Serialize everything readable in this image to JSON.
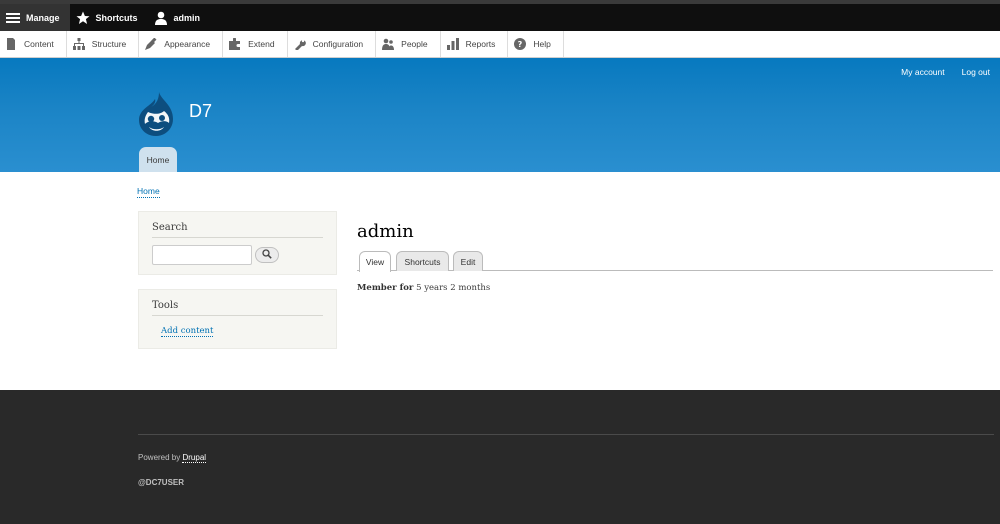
{
  "toolbar": {
    "manage_label": "Manage",
    "shortcuts_label": "Shortcuts",
    "user_label": "admin"
  },
  "tray": {
    "items": [
      {
        "label": "Content",
        "icon": "content-icon"
      },
      {
        "label": "Structure",
        "icon": "structure-icon"
      },
      {
        "label": "Appearance",
        "icon": "appearance-icon"
      },
      {
        "label": "Extend",
        "icon": "extend-icon"
      },
      {
        "label": "Configuration",
        "icon": "configuration-icon"
      },
      {
        "label": "People",
        "icon": "people-icon"
      },
      {
        "label": "Reports",
        "icon": "reports-icon"
      },
      {
        "label": "Help",
        "icon": "help-icon"
      }
    ]
  },
  "header": {
    "secondary_menu": [
      "My account",
      "Log out"
    ],
    "site_name": "D7",
    "main_menu_home": "Home"
  },
  "breadcrumb": "Home",
  "sidebar": {
    "search_title": "Search",
    "tools_title": "Tools",
    "tools_link": "Add content"
  },
  "main": {
    "title": "admin",
    "tabs": [
      "View",
      "Shortcuts",
      "Edit"
    ],
    "member_label": "Member for",
    "member_value": "5 years 2 months"
  },
  "footer": {
    "powered_prefix": "Powered by",
    "powered_link": "Drupal",
    "user": "@DC7USER"
  },
  "colors": {
    "header_blue": "#0779bf",
    "link_blue": "#0071b3",
    "footer_bg": "#292929",
    "toolbar_bg": "#0f0f0f"
  }
}
